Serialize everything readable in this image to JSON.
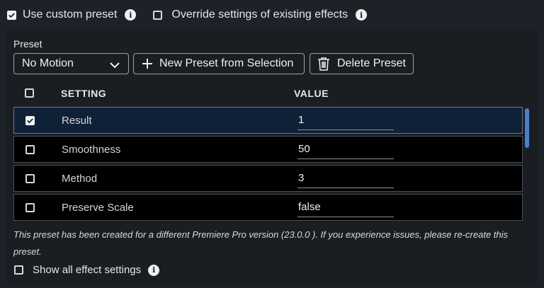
{
  "options": {
    "use_custom_preset": {
      "label": "Use custom preset",
      "checked": true
    },
    "override_settings": {
      "label": "Override settings of existing effects",
      "checked": false
    }
  },
  "preset": {
    "label": "Preset",
    "selected": "No Motion",
    "new_button": "New Preset from Selection",
    "delete_button": "Delete Preset"
  },
  "table": {
    "headers": {
      "setting": "SETTING",
      "value": "VALUE"
    },
    "rows": [
      {
        "name": "Result",
        "value": "1",
        "checked": true
      },
      {
        "name": "Smoothness",
        "value": "50",
        "checked": false
      },
      {
        "name": "Method",
        "value": "3",
        "checked": false
      },
      {
        "name": "Preserve Scale",
        "value": "false",
        "checked": false
      }
    ]
  },
  "note": "This preset has been created for a different Premiere Pro version (23.0.0 ). If you experience issues, please re-create this preset.",
  "show_all": {
    "label": "Show all effect settings",
    "checked": false
  },
  "colors": {
    "background": "#1d2228",
    "selected_row": "#0e2136",
    "scroll_thumb": "#4a7fd0"
  }
}
